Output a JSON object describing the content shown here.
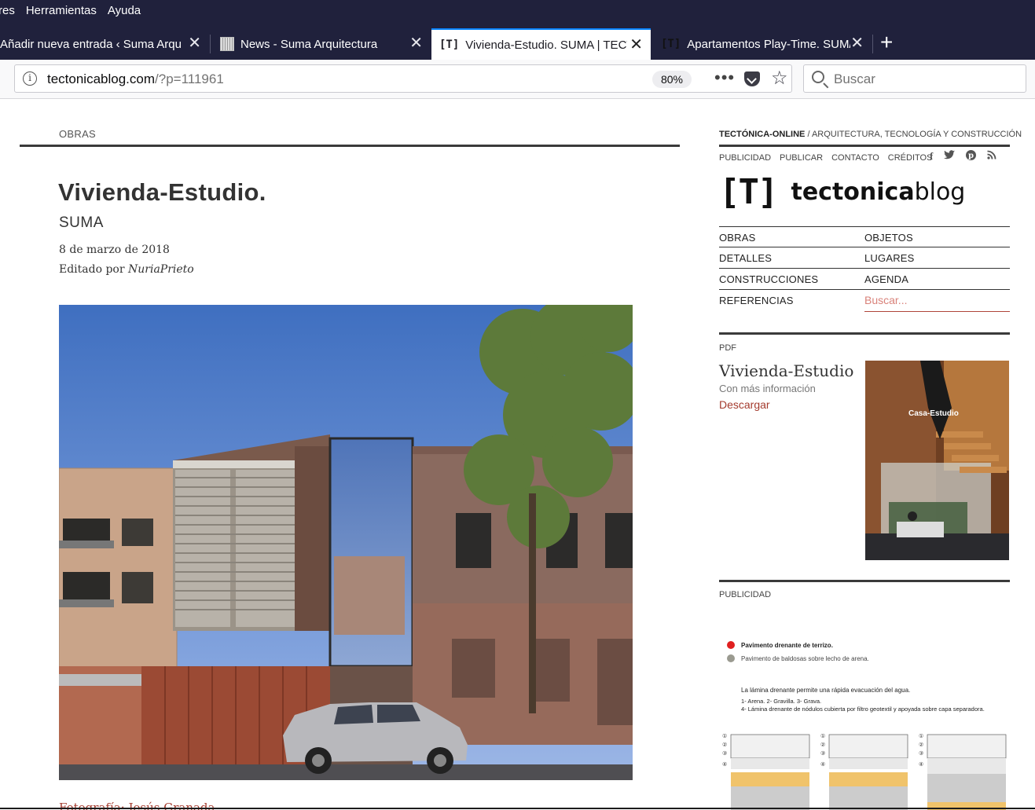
{
  "menu": {
    "items": [
      "res",
      "Herramientas",
      "Ayuda"
    ]
  },
  "tabs": [
    {
      "title": "Añadir nueva entrada ‹ Suma Arqui",
      "favicon": "wordpress"
    },
    {
      "title": "News - Suma Arquitectura",
      "favicon": "news-grid"
    },
    {
      "title": "Vivienda-Estudio. SUMA | TECT",
      "favicon": "[T]",
      "active": true
    },
    {
      "title": "Apartamentos Play-Time. SUM/",
      "favicon": "[T]"
    }
  ],
  "newtab": "+",
  "urlbar": {
    "host": "tectonicablog.com",
    "path": "/?p=111961",
    "zoom": "80%",
    "more": "•••"
  },
  "searchbar": {
    "placeholder": "Buscar"
  },
  "article": {
    "category": "OBRAS",
    "title": "Vivienda-Estudio.",
    "author": "SUMA",
    "date": "8 de marzo de 2018",
    "edited_prefix": "Editado por ",
    "editor": "NuriaPrieto",
    "photo_credit": "Fotografía: Jesús Granada"
  },
  "sidebar": {
    "site_name": "TECTÓNICA-ONLINE",
    "site_tagline": " / ARQUITECTURA, TECNOLOGÍA Y CONSTRUCCIÓN",
    "links": [
      "PUBLICIDAD",
      "PUBLICAR",
      "CONTACTO",
      "CRÉDITOS"
    ],
    "social": [
      "f",
      "t",
      "p",
      "rss"
    ],
    "logo_mark": "[T]",
    "logo_bold": "tectonica",
    "logo_light": "blog",
    "nav": [
      [
        "OBRAS",
        "OBJETOS"
      ],
      [
        "DETALLES",
        "LUGARES"
      ],
      [
        "CONSTRUCCIONES",
        "AGENDA"
      ]
    ],
    "nav_last": "REFERENCIAS",
    "nav_search_placeholder": "Buscar...",
    "pdf": {
      "label": "PDF",
      "title": "Vivienda-Estudio",
      "more": "Con más información",
      "download": "Descargar",
      "cover_text": "Casa-Estudio"
    },
    "ad": {
      "label": "PUBLICIDAD",
      "legend1": "Pavimento drenante de terrizo.",
      "legend2": "Pavimento de baldosas sobre lecho de arena.",
      "line1": "La lámina drenante permite una rápida evacuación del agua.",
      "line2": "1- Arena.     2- Gravilla.     3- Grava.",
      "line3": "4- Lámina drenante de nódulos cubierta por filtro geotextil y apoyada sobre capa separadora."
    }
  },
  "colors": {
    "chrome_bg": "#20213c",
    "accent_red": "#a43b2e",
    "tab_highlight": "#0a84ff"
  }
}
